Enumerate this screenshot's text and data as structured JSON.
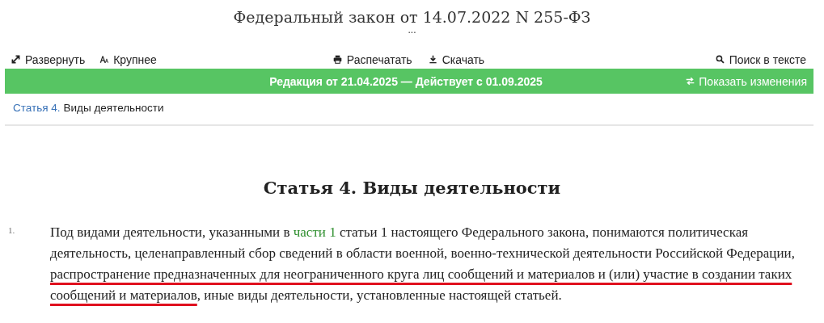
{
  "document": {
    "title": "Федеральный закон от 14.07.2022 N 255-ФЗ",
    "more": "..."
  },
  "toolbar": {
    "left": [
      {
        "label": "Развернуть",
        "kind": "expand"
      },
      {
        "label": "Крупнее",
        "kind": "font"
      }
    ],
    "center": [
      {
        "label": "Распечатать",
        "kind": "print"
      },
      {
        "label": "Скачать",
        "kind": "download"
      }
    ],
    "right": [
      {
        "label": "Поиск в тексте",
        "kind": "search"
      }
    ]
  },
  "edition_bar": {
    "text": "Редакция от 21.04.2025 — Действует с 01.09.2025",
    "action": "Показать изменения"
  },
  "breadcrumb": {
    "link": "Статья 4.",
    "current": "Виды деятельности"
  },
  "article": {
    "heading": "Статья 4. Виды деятельности",
    "items": [
      {
        "number": "1.",
        "segments": [
          {
            "kind": "plain",
            "text": "Под видами деятельности, указанными в "
          },
          {
            "kind": "link",
            "text": "части 1"
          },
          {
            "kind": "plain",
            "text": " статьи 1 настоящего Федерального закона, понимаются политическая деятельность, целенаправленный сбор сведений в области военной, военно-технической деятельности Российской Федерации, "
          },
          {
            "kind": "marked",
            "text": "распространение предназначенных для неограниченного круга лиц сообщений и материалов и (или) участие в создании таких сообщений и материалов"
          },
          {
            "kind": "plain",
            "text": ", иные виды деятельности, установленные настоящей статьей."
          }
        ]
      }
    ]
  }
}
